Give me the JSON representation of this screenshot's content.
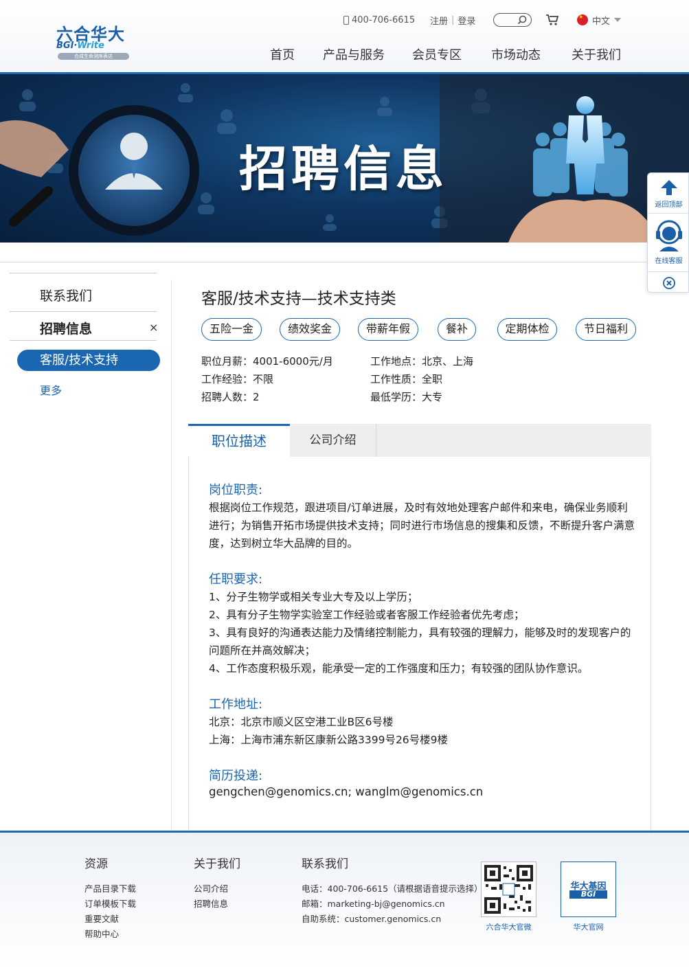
{
  "header": {
    "logo_cn": "六合华大",
    "logo_en_prefix": "BGI·",
    "logo_en_suffix": "Write",
    "logo_sub": "合成生命测序表达",
    "phone": "400-706-6615",
    "register": "注册",
    "login": "登录",
    "language": "中文",
    "nav": [
      "首页",
      "产品与服务",
      "会员专区",
      "市场动态",
      "关于我们"
    ]
  },
  "banner": {
    "title": "招聘信息"
  },
  "float_tools": {
    "top": "返回顶部",
    "service": "在线客服"
  },
  "sidebar": {
    "items": [
      "联系我们",
      "招聘信息"
    ],
    "active": "客服/技术支持",
    "more": "更多"
  },
  "job": {
    "title": "客服/技术支持—技术支持类",
    "tags": [
      "五险一金",
      "绩效奖金",
      "带薪年假",
      "餐补",
      "定期体检",
      "节日福利"
    ],
    "info": {
      "salary": "职位月薪：4001-6000元/月",
      "location": "工作地点：北京、上海",
      "experience": "工作经验：不限",
      "type": "工作性质：全职",
      "headcount": "招聘人数：2",
      "education": "最低学历：大专"
    }
  },
  "tabs": {
    "active": "职位描述",
    "other": "公司介绍"
  },
  "content": {
    "duty_head": "岗位职责:",
    "duty_lines": [
      "根据岗位工作规范，跟进项目/订单进展，及时有效地处理客户邮件和来电，确保业务顺利",
      "进行；为销售开拓市场提供技术支持；同时进行市场信息的搜集和反馈，不断提升客户满意",
      "度，达到树立华大品牌的目的。"
    ],
    "req_head": "任职要求:",
    "req_lines": [
      "1、分子生物学或相关专业大专及以上学历；",
      "2、具有分子生物学实验室工作经验或者客服工作经验者优先考虑；",
      "3、具有良好的沟通表达能力及情绪控制能力，具有较强的理解力，能够及时的发现客户的",
      "问题所在并高效解决；",
      "4、工作态度积极乐观，能承受一定的工作强度和压力；有较强的团队协作意识。"
    ],
    "addr_head": "工作地址:",
    "addr_lines": [
      "北京：北京市顺义区空港工业B区6号楼",
      "上海：上海市浦东新区康新公路3399号26号楼9楼"
    ],
    "resume_head": "简历投递:",
    "resume_emails": "gengchen@genomics.cn; wanglm@genomics.cn"
  },
  "footer": {
    "resources_head": "资源",
    "resources": [
      "产品目录下载",
      "订单模板下载",
      "重要文献",
      "帮助中心"
    ],
    "about_head": "关于我们",
    "about": [
      "公司介绍",
      "招聘信息"
    ],
    "contact_head": "联系我们",
    "contact": [
      "电话：400-706-6615（请根据语音提示选择）",
      "邮箱：marketing-bj@genomics.cn",
      "自助系统：customer.genomics.cn"
    ],
    "qr1_caption": "六合华大官微",
    "qr2_caption": "华大官网",
    "qr2_logo_cn": "华大基因",
    "qr2_logo_en": "BGI"
  },
  "colors": {
    "accent": "#1a66b0",
    "banner_dark": "#0e3560"
  }
}
